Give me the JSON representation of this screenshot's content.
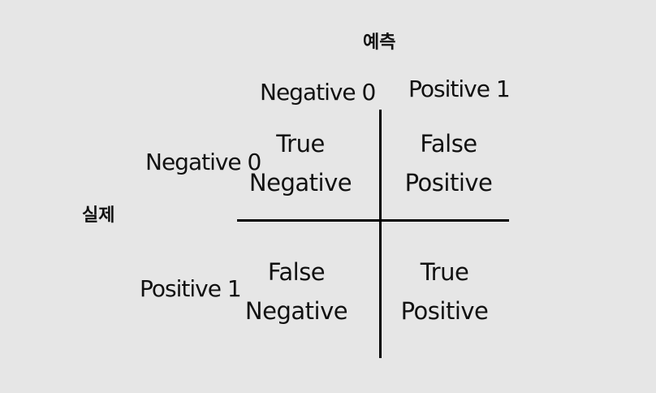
{
  "axis_labels": {
    "predicted": "예측",
    "actual": "실제"
  },
  "columns": {
    "negative": "Negative 0",
    "positive": "Positive 1"
  },
  "rows": {
    "negative": "Negative 0",
    "positive": "Positive 1"
  },
  "cells": {
    "true_negative": {
      "line1": "True",
      "line2": "Negative"
    },
    "false_positive": {
      "line1": "False",
      "line2": "Positive"
    },
    "false_negative": {
      "line1": "False",
      "line2": "Negative"
    },
    "true_positive": {
      "line1": "True",
      "line2": "Positive"
    }
  }
}
